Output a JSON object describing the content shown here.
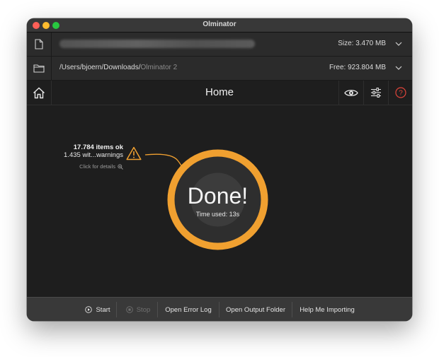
{
  "window": {
    "title": "Olminator",
    "colors": {
      "close": "#ff5f57",
      "minimize": "#febc2e",
      "maximize": "#28c840"
    }
  },
  "file_row": {
    "icon": "file-icon",
    "path": "",
    "size": "Size: 3.470 MB"
  },
  "folder_row": {
    "icon": "folder-icon",
    "path_main": "/Users/bjoern/Downloads/",
    "path_folder": "Olminator 2",
    "free": "Free: 923.804 MB"
  },
  "toolbar": {
    "title": "Home",
    "icons": [
      "home-icon",
      "eye-icon",
      "sliders-icon",
      "help-icon"
    ]
  },
  "result": {
    "summary_ok": "17.784 items ok",
    "summary_warnings": "1.435 wit...warnings",
    "details_link": "Click for details",
    "status": "Done!",
    "time_used": "Time used: 13s",
    "ring_color": "#f0a030",
    "warning_color": "#f0a030"
  },
  "bottom_bar": {
    "start": "Start",
    "stop": "Stop",
    "open_error_log": "Open Error Log",
    "open_output_folder": "Open Output Folder",
    "help_importing": "Help Me Importing"
  }
}
